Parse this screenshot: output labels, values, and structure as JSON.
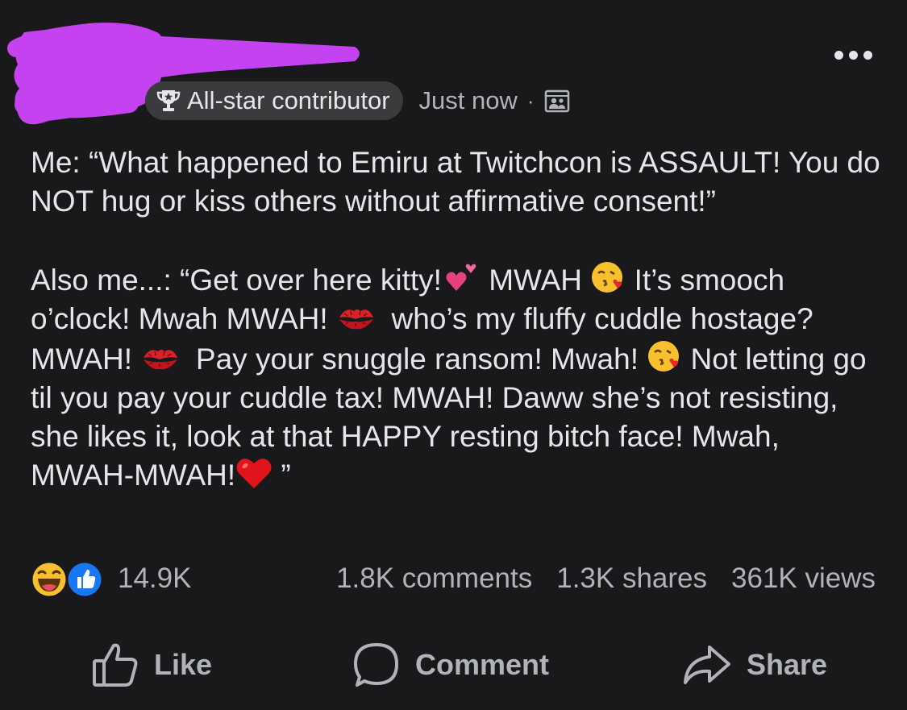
{
  "post": {
    "badge": {
      "icon": "trophy-icon",
      "label": "All-star contributor"
    },
    "timestamp": "Just now",
    "separator": "·",
    "audience_icon": "friends-audience-icon",
    "more_icon": "more-options-icon",
    "body": {
      "paragraph1": "Me: “What happened to Emiru at Twitchcon is ASSAULT! You do NOT hug or kiss others without affirmative consent!”",
      "p2_seg1": "Also me...: “Get over here kitty!",
      "p2_seg2": " MWAH ",
      "p2_seg3": " It’s smooch o’clock! Mwah MWAH! ",
      "p2_seg4": "  who’s my fluffy cuddle hostage? MWAH! ",
      "p2_seg5": "  Pay your snuggle ransom! Mwah! ",
      "p2_seg6": " Not letting go til you pay your cuddle tax! MWAH! Daww she’s not resisting, she likes it, look at that HAPPY resting bitch face! Mwah, MWAH-MWAH!",
      "p2_seg7": " ”"
    },
    "emojis": [
      "two-hearts",
      "face-blowing-kiss",
      "kiss-mark",
      "kiss-mark",
      "face-blowing-kiss",
      "red-heart"
    ]
  },
  "stats": {
    "reactions": [
      "haha",
      "like"
    ],
    "reaction_count": "14.9K",
    "comments": "1.8K comments",
    "shares": "1.3K shares",
    "views": "361K views"
  },
  "actions": {
    "like": "Like",
    "comment": "Comment",
    "share": "Share"
  },
  "colors": {
    "background": "#19191b",
    "text_primary": "#e4e6eb",
    "text_secondary": "#b0b3b8",
    "badge_bg": "#3a3b3d",
    "redaction": "#c542f0",
    "like_blue": "#1877f2"
  }
}
